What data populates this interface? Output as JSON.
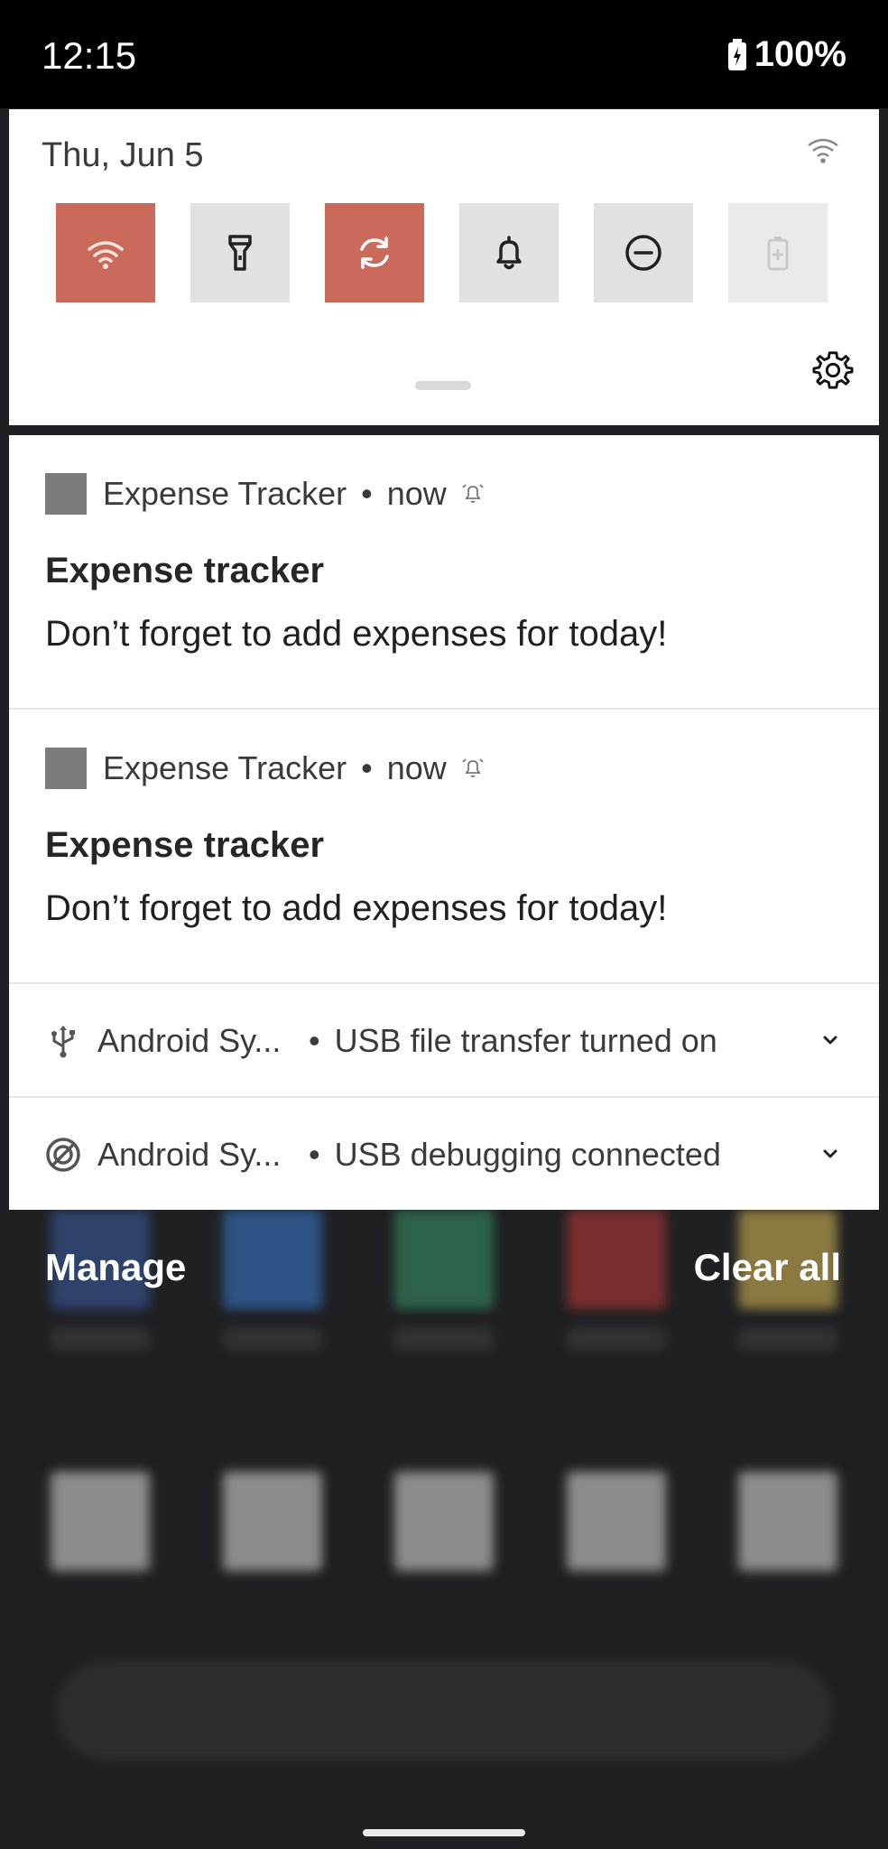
{
  "status_bar": {
    "time": "12:15",
    "battery": "100%"
  },
  "quick_settings": {
    "date": "Thu, Jun 5",
    "tiles": [
      {
        "name": "wifi",
        "active": true,
        "icon": "wifi-icon"
      },
      {
        "name": "flashlight",
        "active": false,
        "icon": "flashlight-icon"
      },
      {
        "name": "auto-rotate",
        "active": true,
        "icon": "rotate-icon"
      },
      {
        "name": "sound",
        "active": false,
        "icon": "bell-icon"
      },
      {
        "name": "do-not-disturb",
        "active": false,
        "icon": "dnd-icon"
      },
      {
        "name": "battery-saver",
        "active": false,
        "icon": "battery-icon"
      }
    ],
    "accent_color": "#c96a5a"
  },
  "notifications": [
    {
      "app": "Expense Tracker",
      "time": "now",
      "title": "Expense tracker",
      "text": "Don’t forget to add expenses for today!"
    },
    {
      "app": "Expense Tracker",
      "time": "now",
      "title": "Expense tracker",
      "text": "Don’t forget to add expenses for today!"
    }
  ],
  "system_notifications": [
    {
      "app": "Android Sy...",
      "text": "USB file transfer turned on",
      "icon": "usb-icon"
    },
    {
      "app": "Android Sy...",
      "text": "USB debugging connected",
      "icon": "android-debug-icon"
    }
  ],
  "footer": {
    "manage": "Manage",
    "clear_all": "Clear all"
  }
}
